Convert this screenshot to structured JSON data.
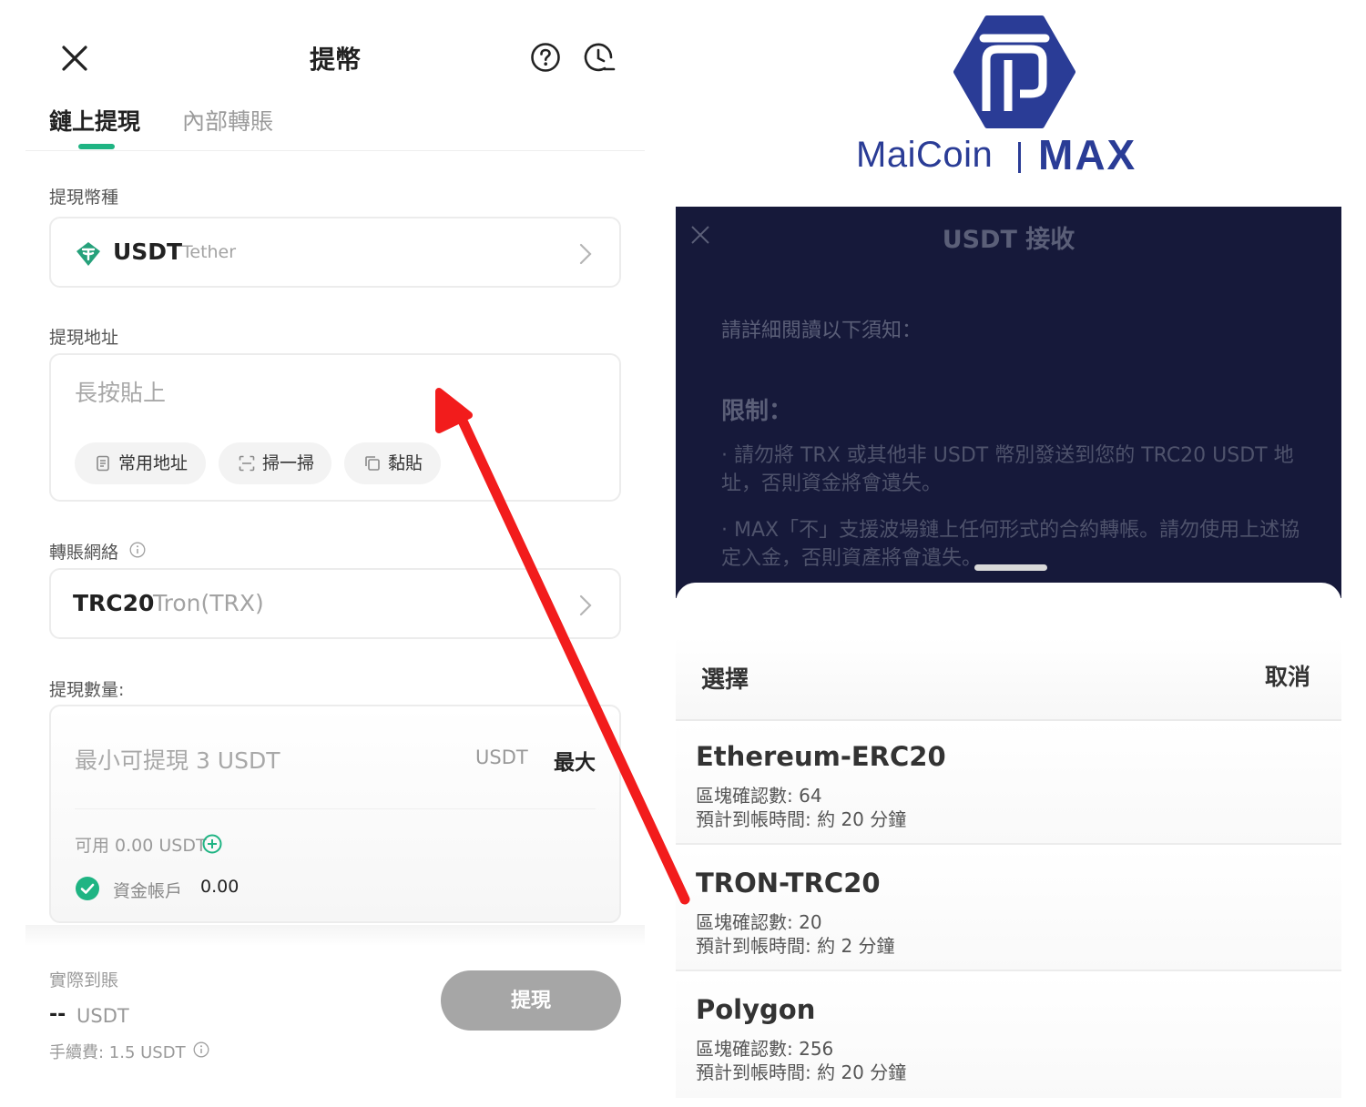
{
  "withdraw": {
    "title": "提幣",
    "tabs": [
      {
        "label": "鏈上提現",
        "active": true
      },
      {
        "label": "內部轉賬",
        "active": false
      }
    ],
    "coin": {
      "label": "提現幣種",
      "code": "USDT",
      "name": "Tether",
      "icon": "tether-icon"
    },
    "address": {
      "label": "提現地址",
      "placeholder": "長按貼上",
      "actions": [
        {
          "label": "常用地址",
          "icon": "address-book-icon"
        },
        {
          "label": "掃一掃",
          "icon": "scan-icon"
        },
        {
          "label": "黏貼",
          "icon": "paste-icon"
        }
      ]
    },
    "network": {
      "label": "轉賬網絡",
      "code": "TRC20",
      "name": "Tron(TRX)"
    },
    "amount": {
      "label": "提現數量:",
      "placeholder": "最小可提現 3 USDT",
      "unit": "USDT",
      "max_label": "最大",
      "available": "可用 0.00 USDT",
      "fund_account_label": "資金帳戶",
      "fund_account_value": "0.00"
    },
    "summary": {
      "actual_label": "實際到賬",
      "actual_value": "--",
      "actual_unit": "USDT",
      "fee": "手續費: 1.5 USDT"
    },
    "submit_label": "提現",
    "colors": {
      "accent": "#1fb483",
      "button_disabled": "#a6a6a6"
    }
  },
  "brand": {
    "name": "MaiCoin",
    "product": "MAX",
    "color": "#2a3c96"
  },
  "receive": {
    "title": "USDT 接收",
    "notice": "請詳細閱讀以下須知：",
    "limit_heading": "限制：",
    "bullets": [
      "· 請勿將 TRX 或其他非 USDT 幣別發送到您的 TRC20 USDT 地址，否則資金將會遺失。",
      "· MAX「不」支援波場鏈上任何形式的合約轉帳。請勿使用上述協定入金，否則資產將會遺失。"
    ]
  },
  "network_sheet": {
    "title": "選擇",
    "cancel_label": "取消",
    "options": [
      {
        "name": "Ethereum-ERC20",
        "confirmations": "區塊確認數: 64",
        "eta": "預計到帳時間: 約 20 分鐘"
      },
      {
        "name": "TRON-TRC20",
        "confirmations": "區塊確認數: 20",
        "eta": "預計到帳時間: 約 2 分鐘"
      },
      {
        "name": "Polygon",
        "confirmations": "區塊確認數: 256",
        "eta": "預計到帳時間: 約 20 分鐘"
      }
    ]
  },
  "annotation": {
    "color": "#f21c1c",
    "type": "arrow"
  }
}
